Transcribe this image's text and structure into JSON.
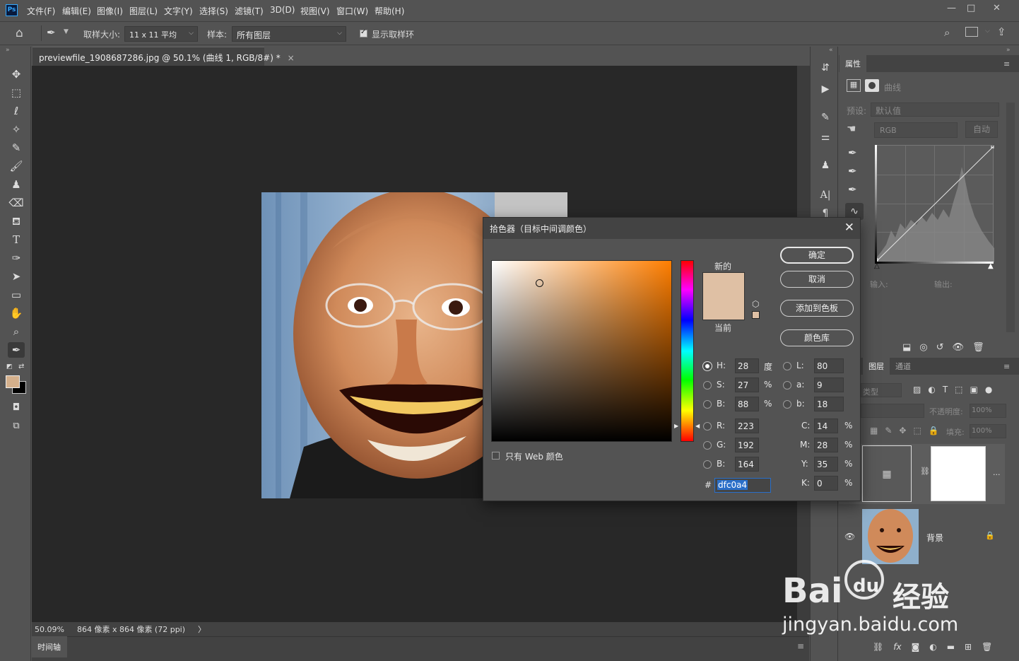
{
  "menubar": {
    "logo": "Ps",
    "items": [
      "文件(F)",
      "编辑(E)",
      "图像(I)",
      "图层(L)",
      "文字(Y)",
      "选择(S)",
      "滤镜(T)",
      "3D(D)",
      "视图(V)",
      "窗口(W)",
      "帮助(H)"
    ],
    "window_controls": [
      "—",
      "□",
      "✕"
    ]
  },
  "options": {
    "sample_size_label": "取样大小:",
    "sample_size_value": "11 x 11 平均",
    "sample_label": "样本:",
    "sample_value": "所有图层",
    "show_ring_label": "显示取样环"
  },
  "document": {
    "tab_title": "previewfile_1908687286.jpg @ 50.1% (曲线 1, RGB/8#) *",
    "tab_close": "×",
    "zoom": "50.09%",
    "dimensions": "864 像素 x 864 像素 (72 ppi)",
    "status_arrow": "〉",
    "timeline_tab": "时间轴"
  },
  "properties_panel": {
    "tab": "属性",
    "adjustment_name": "曲线",
    "preset_label": "预设:",
    "preset_value": "默认值",
    "channel_value": "RGB",
    "auto_label": "自动",
    "input_label": "输入:",
    "output_label": "输出:"
  },
  "layers_panel": {
    "tabs": [
      "图层",
      "通道"
    ],
    "kind_label": "类型",
    "opacity_label": "不透明度:",
    "opacity_value": "100%",
    "fill_label": "填充:",
    "fill_value": "100%",
    "layers": [
      {
        "name": "",
        "type": "curves"
      },
      {
        "name": "背景",
        "type": "image"
      }
    ],
    "more": "..."
  },
  "color_picker": {
    "title": "拾色器（目标中间调颜色）",
    "close": "✕",
    "new_label": "新的",
    "current_label": "当前",
    "new_color": "#dfc0a4",
    "current_color": "#dfc0a4",
    "buttons": {
      "ok": "确定",
      "cancel": "取消",
      "add_to_swatches": "添加到色板",
      "color_libraries": "颜色库"
    },
    "hsb": {
      "h_label": "H:",
      "h": "28",
      "h_unit": "度",
      "s_label": "S:",
      "s": "27",
      "s_unit": "%",
      "b_label": "B:",
      "b": "88",
      "b_unit": "%"
    },
    "lab": {
      "l_label": "L:",
      "l": "80",
      "a_label": "a:",
      "a": "9",
      "b_label": "b:",
      "b": "18"
    },
    "rgb": {
      "r_label": "R:",
      "r": "223",
      "g_label": "G:",
      "g": "192",
      "b_label": "B:",
      "b": "164"
    },
    "cmyk": {
      "c_label": "C:",
      "c": "14",
      "m_label": "M:",
      "m": "28",
      "y_label": "Y:",
      "y": "35",
      "k_label": "K:",
      "k": "0",
      "unit": "%"
    },
    "hex_label": "#",
    "hex": "dfc0a4",
    "web_only_label": "只有 Web 颜色"
  },
  "watermark": {
    "brand": "Bai",
    "brand2": "du",
    "product": "经验",
    "url": "jingyan.baidu.com"
  },
  "colors": {
    "accent": "#31a8ff",
    "foreground": "#d4b08c",
    "background": "#000000"
  }
}
